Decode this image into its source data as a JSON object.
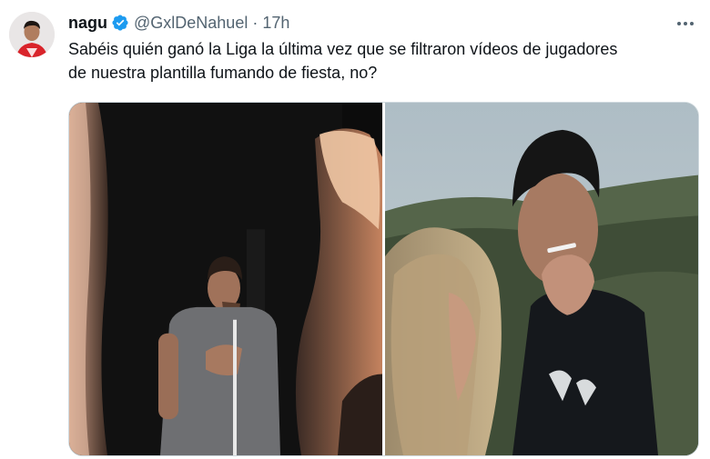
{
  "tweet": {
    "author_name": "nagu",
    "handle": "@GxlDeNahuel",
    "separator": "·",
    "time": "17h",
    "text": "Sabéis quién ganó la Liga la última vez que se filtraron vídeos de jugadores\nde nuestra plantilla fumando de fiesta, no?",
    "verified": true
  },
  "colors": {
    "verified_badge": "#1d9bf0",
    "text_primary": "#0f1419",
    "text_secondary": "#536471",
    "media_border": "#cfd9de"
  },
  "icons": {
    "verified": "verified-badge-icon",
    "more": "more-dots-icon"
  },
  "media": {
    "count": 2
  }
}
